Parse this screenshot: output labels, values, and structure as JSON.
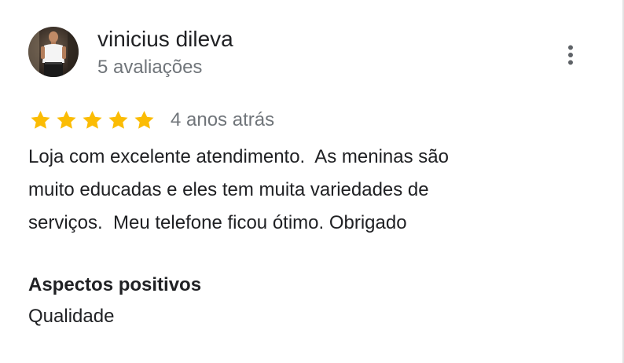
{
  "review": {
    "author": {
      "name": "vinicius dileva",
      "review_count": "5 avaliações",
      "avatar_icon": "user-photo"
    },
    "menu_icon": "more-vert-icon",
    "rating": {
      "stars": 5,
      "max_stars": 5,
      "star_color": "#fbbc04",
      "date": "4 anos atrás"
    },
    "text_lines": [
      "Loja com excelente atendimento.  As meninas são",
      "muito educadas e eles tem muita variedades de",
      "serviços.  Meu telefone ficou ótimo. Obrigado"
    ],
    "aspects": {
      "title": "Aspectos positivos",
      "value": "Qualidade"
    }
  },
  "colors": {
    "primary_text": "#202124",
    "secondary_text": "#70757a",
    "star": "#fbbc04",
    "icon": "#5f6368"
  }
}
